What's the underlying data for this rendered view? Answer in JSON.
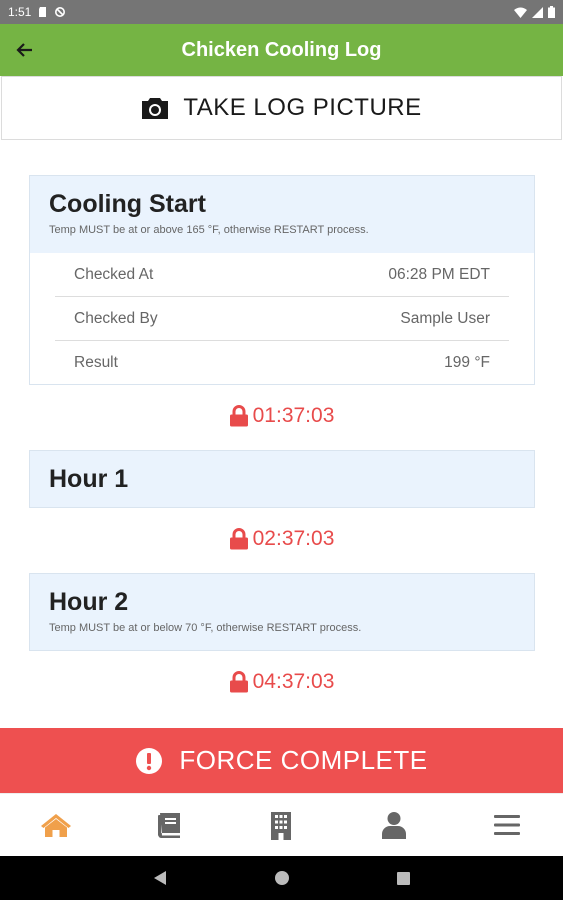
{
  "status_bar": {
    "time": "1:51"
  },
  "app_bar": {
    "title": "Chicken Cooling Log"
  },
  "photo_button": {
    "label": "TAKE LOG PICTURE"
  },
  "sections": {
    "cooling_start": {
      "title": "Cooling Start",
      "subtitle": "Temp MUST be at or above 165 °F, otherwise RESTART process.",
      "rows": [
        {
          "label": "Checked At",
          "value": "06:28 PM EDT"
        },
        {
          "label": "Checked By",
          "value": "Sample User"
        },
        {
          "label": "Result",
          "value": "199 °F"
        }
      ],
      "timer": "01:37:03"
    },
    "hour1": {
      "title": "Hour 1",
      "timer": "02:37:03"
    },
    "hour2": {
      "title": "Hour 2",
      "subtitle": "Temp MUST be at or below 70 °F, otherwise RESTART process.",
      "timer": "04:37:03"
    }
  },
  "force_button": {
    "label": "FORCE COMPLETE"
  },
  "bottom_nav": {
    "items": [
      {
        "icon": "home-icon",
        "active": true
      },
      {
        "icon": "book-icon",
        "active": false
      },
      {
        "icon": "building-icon",
        "active": false
      },
      {
        "icon": "user-icon",
        "active": false
      },
      {
        "icon": "menu-icon",
        "active": false
      }
    ]
  },
  "colors": {
    "app_bar": "#75b444",
    "danger": "#ee5050",
    "timer": "#e84b4b",
    "card_header": "#eaf3fd",
    "nav_active": "#f0a04b",
    "nav_inactive": "#666666"
  }
}
